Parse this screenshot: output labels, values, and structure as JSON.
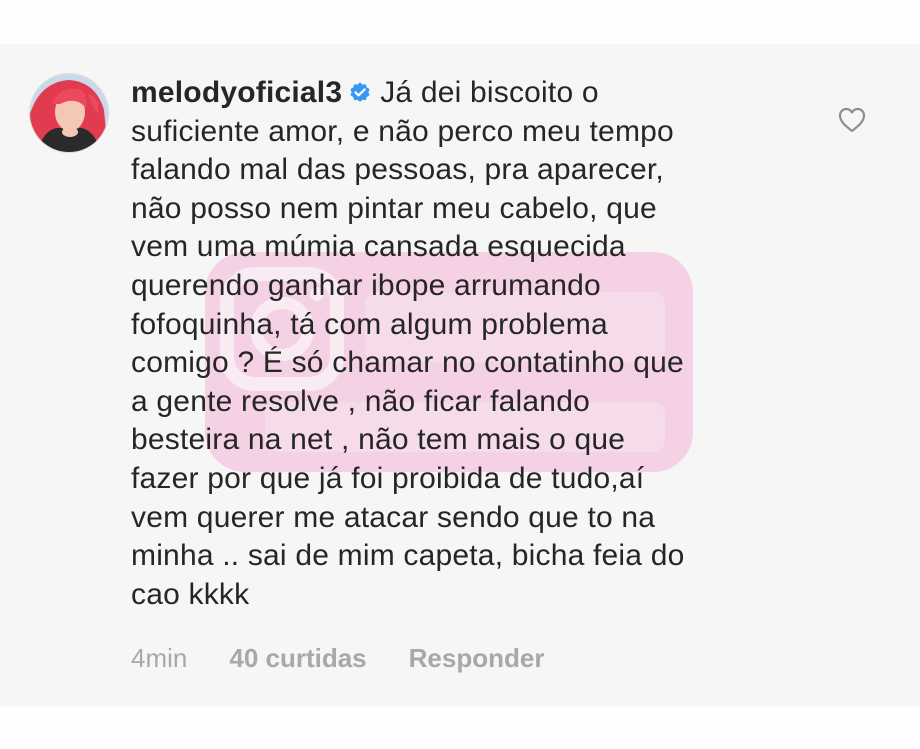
{
  "comment": {
    "username": "melodyoficial3",
    "verified_icon": "verified-badge-icon",
    "text": "Já dei biscoito o\nsuficiente amor, e não perco meu tempo\nfalando mal das pessoas, pra aparecer,\nnão posso nem pintar meu cabelo, que\nvem uma múmia cansada esquecida\nquerendo ganhar ibope arrumando\nfofoquinha, tá com algum problema\ncomigo ? É só chamar no contatinho que\na gente resolve , não ficar falando\nbesteira na net , não tem mais o que\nfazer por que já foi proibida de tudo,aí\nvem querer me atacar sendo que to na\nminha .. sai de mim capeta, bicha feia do\ncao kkkk",
    "time": "4min",
    "likes": "40 curtidas",
    "reply": "Responder",
    "like_icon": "heart-outline-icon"
  },
  "colors": {
    "text": "#262626",
    "meta": "#a8a8a8",
    "verified": "#3897f0",
    "watermark": "#f0a9d0"
  }
}
